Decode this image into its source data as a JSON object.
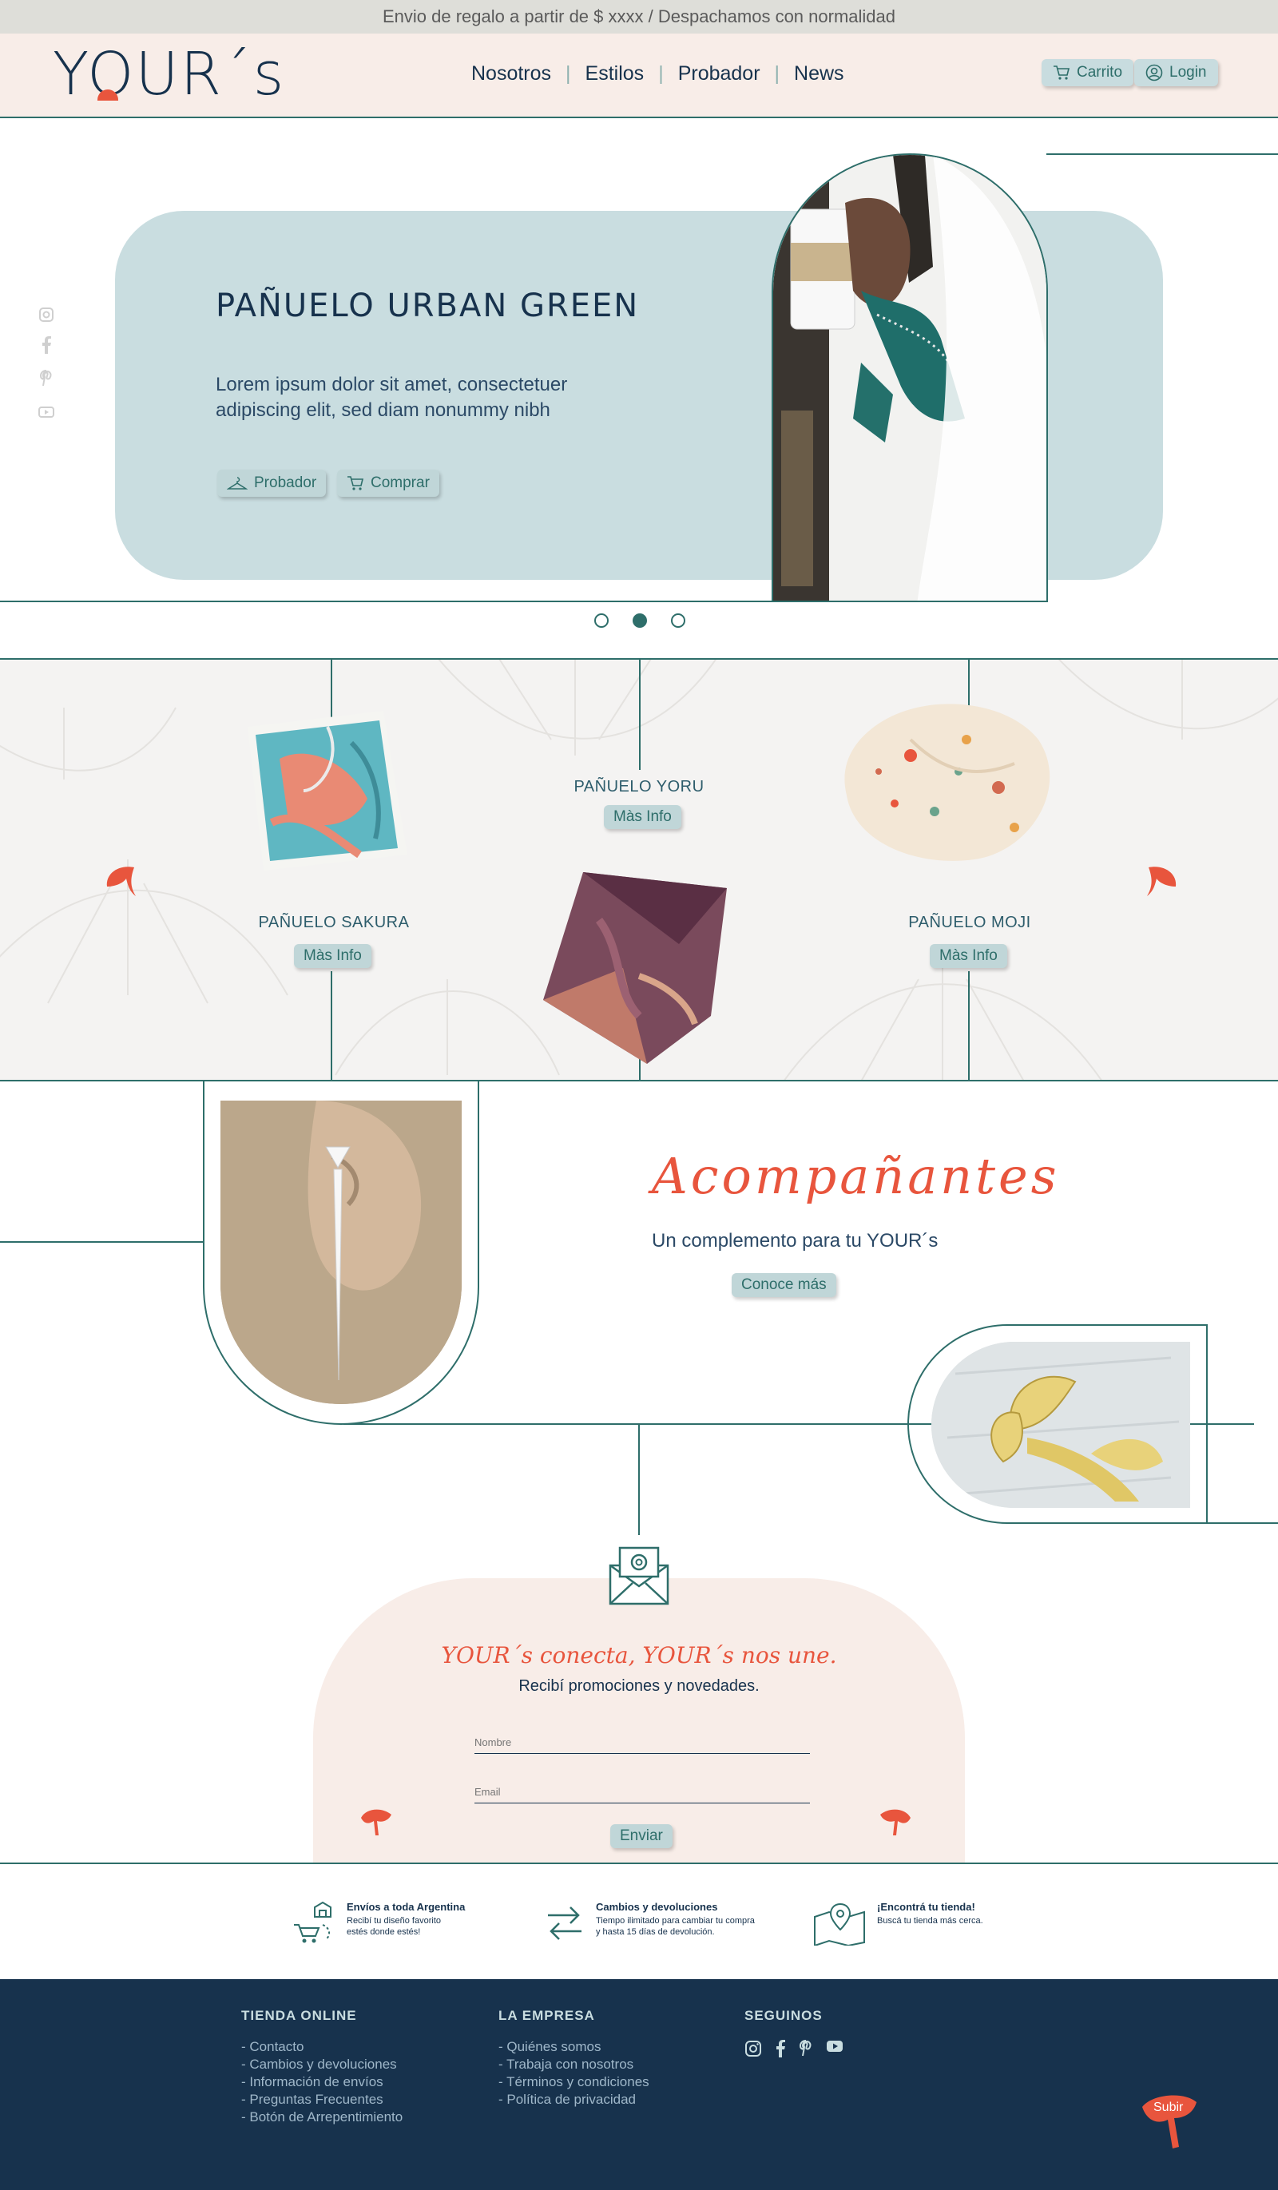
{
  "announcement": "Envio de regalo a partir de $ xxxx / Despachamos con normalidad",
  "brand": {
    "logo": "YOUR´s",
    "accent": "#e8553d",
    "primary": "#17324d",
    "teal": "#2e6e6a",
    "light_blue": "#c9dde0",
    "cream": "#f8ede8"
  },
  "nav": {
    "items": [
      "Nosotros",
      "Estilos",
      "Probador",
      "News"
    ]
  },
  "header_buttons": {
    "cart": "Carrito",
    "login": "Login"
  },
  "hero": {
    "title": "PAÑUELO URBAN GREEN",
    "text": "Lorem ipsum dolor sit amet, consectetuer adipiscing elit, sed diam nonummy nibh",
    "btn_try": "Probador",
    "btn_buy": "Comprar",
    "social_icons": [
      "instagram-icon",
      "facebook-icon",
      "pinterest-icon",
      "youtube-icon"
    ],
    "slide_index": 2,
    "slide_count": 3
  },
  "products": [
    {
      "name": "PAÑUELO SAKURA",
      "button": "Màs Info"
    },
    {
      "name": "PAÑUELO YORU",
      "button": "Màs Info"
    },
    {
      "name": "PAÑUELO MOJI",
      "button": "Màs Info"
    }
  ],
  "accompaniments": {
    "title": "Acompañantes",
    "subtitle": "Un complemento para tu YOUR´s",
    "button": "Conoce más"
  },
  "newsletter": {
    "title": "YOUR´s conecta, YOUR´s nos une.",
    "subtitle": "Recibí promociones y novedades.",
    "name_label": "Nombre",
    "email_label": "Email",
    "submit": "Enviar"
  },
  "features": [
    {
      "title": "Envíos a toda Argentina",
      "text_1": "Recibí tu diseño favorito",
      "text_2": "estés donde estés!"
    },
    {
      "title": "Cambios y devoluciones",
      "text_1": "Tiempo ilimitado para cambiar tu compra",
      "text_2": "y hasta 15 días de devolución."
    },
    {
      "title": "¡Encontrá tu tienda!",
      "text_1": "Buscá tu tienda más cerca.",
      "text_2": ""
    }
  ],
  "footer": {
    "col1": {
      "title": "TIENDA ONLINE",
      "items": [
        "- Contacto",
        "- Cambios y devoluciones",
        "- Información de envíos",
        "- Preguntas Frecuentes",
        "- Botón de Arrepentimiento"
      ]
    },
    "col2": {
      "title": "LA EMPRESA",
      "items": [
        "- Quiénes somos",
        "- Trabaja con nosotros",
        "- Términos y condiciones",
        "- Política de privacidad"
      ]
    },
    "col3": {
      "title": "SEGUINOS",
      "icons": [
        "instagram-icon",
        "facebook-icon",
        "pinterest-icon",
        "youtube-icon"
      ]
    }
  },
  "scroll_top": "Subir"
}
